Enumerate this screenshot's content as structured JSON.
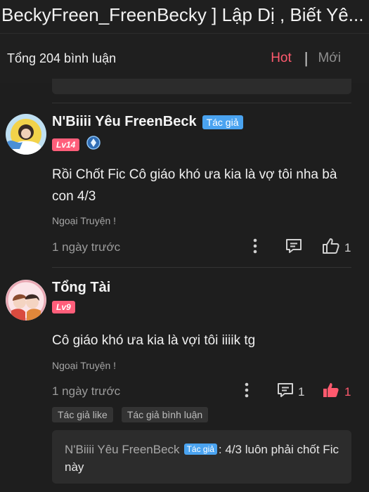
{
  "header": {
    "title": "BeckyFreen_FreenBecky ] Lập Dị , Biết Yê..."
  },
  "summary": {
    "total_label": "Tổng 204 bình luận",
    "sort_hot": "Hot",
    "sort_separator": "|",
    "sort_new": "Mới"
  },
  "comments": [
    {
      "username": "N'Biiii Yêu FreenBeck",
      "author_badge": "Tác giả",
      "level": "Lv14",
      "content": "Rồi Chốt Fic Cô giáo khó ưa kia là vợ tôi nha bà con 4/3",
      "chapter": "Ngoại Truyện !",
      "time": "1 ngày trước",
      "like_count": "1"
    },
    {
      "username": "Tổng Tài",
      "level": "Lv9",
      "content": "Cô giáo khó ưa kia là vợi tôi iiiik tg",
      "chapter": "Ngoại Truyện !",
      "time": "1 ngày trước",
      "reply_count": "1",
      "like_count": "1",
      "tags": [
        "Tác giả like",
        "Tác giả bình luận"
      ],
      "reply": {
        "author": "N'Biiii Yêu FreenBeck",
        "author_badge": "Tác giả",
        "text": ": 4/3 luôn phải chốt Fic này"
      }
    }
  ],
  "colors": {
    "background": "#1e1e1e",
    "accent_hot": "#ff5a6e",
    "author_badge": "#4aa3f0",
    "level_badge": "#ff5e7a",
    "liked": "#ff5a6e"
  },
  "icons": [
    "more-vertical-icon",
    "comment-icon",
    "thumbs-up-icon",
    "thumbs-up-filled-icon",
    "level-diamond-icon"
  ]
}
